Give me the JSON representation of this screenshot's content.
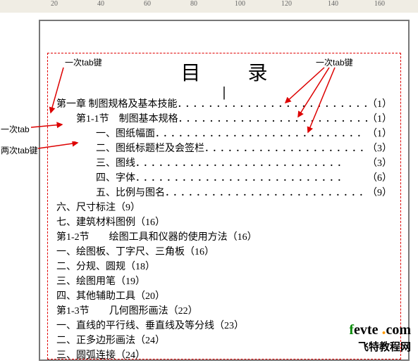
{
  "ruler": {
    "marks": [
      "20",
      "40",
      "60",
      "80",
      "100",
      "120",
      "140",
      "160"
    ]
  },
  "title": "目 录",
  "annotations": {
    "top_left": "一次tab键",
    "top_right": "一次tab键",
    "left1": "一次tab",
    "left2": "两次tab键"
  },
  "toc": [
    {
      "text": "第一章 制图规格及基本技能",
      "page": "（1）",
      "indent": 0,
      "dots": true
    },
    {
      "text": "第1-1节　制图基本规格",
      "page": "（1）",
      "indent": 1,
      "dots": true
    },
    {
      "text": "一、图纸幅面",
      "page": "（1）",
      "indent": 2,
      "dots": true
    },
    {
      "text": "二、图纸标题栏及会签栏",
      "page": "（3）",
      "indent": 2,
      "dots": true
    },
    {
      "text": "三、图线",
      "page": "（3）",
      "indent": 2,
      "dots": true
    },
    {
      "text": "四、字体",
      "page": "（6）",
      "indent": 2,
      "dots": true
    },
    {
      "text": "五、比例与图名",
      "page": "（9）",
      "indent": 2,
      "dots": true
    },
    {
      "text": "六、尺寸标注（9）",
      "page": "",
      "indent": 0,
      "dots": false
    },
    {
      "text": "七、建筑材料图例（16）",
      "page": "",
      "indent": 0,
      "dots": false
    },
    {
      "text": "第1-2节　　绘图工具和仪器的使用方法（16）",
      "page": "",
      "indent": 0,
      "dots": false
    },
    {
      "text": "一、绘图板、丁字尺、三角板（16）",
      "page": "",
      "indent": 0,
      "dots": false
    },
    {
      "text": "二、分规、圆规（18）",
      "page": "",
      "indent": 0,
      "dots": false
    },
    {
      "text": "三、绘图用笔（19）",
      "page": "",
      "indent": 0,
      "dots": false
    },
    {
      "text": "四、其他辅助工具（20）",
      "page": "",
      "indent": 0,
      "dots": false
    },
    {
      "text": "第1-3节　　几何图形画法（22）",
      "page": "",
      "indent": 0,
      "dots": false
    },
    {
      "text": "一、直线的平行线、垂直线及等分线（23）",
      "page": "",
      "indent": 0,
      "dots": false
    },
    {
      "text": "二、正多边形画法（24）",
      "page": "",
      "indent": 0,
      "dots": false
    },
    {
      "text": "三、圆弧连接（24）",
      "page": "",
      "indent": 0,
      "dots": false
    }
  ],
  "watermark": {
    "brand_f": "f",
    "brand_rest": "evte",
    "brand_dot": ".",
    "brand_com": "com",
    "tagline": "飞特教程网"
  }
}
